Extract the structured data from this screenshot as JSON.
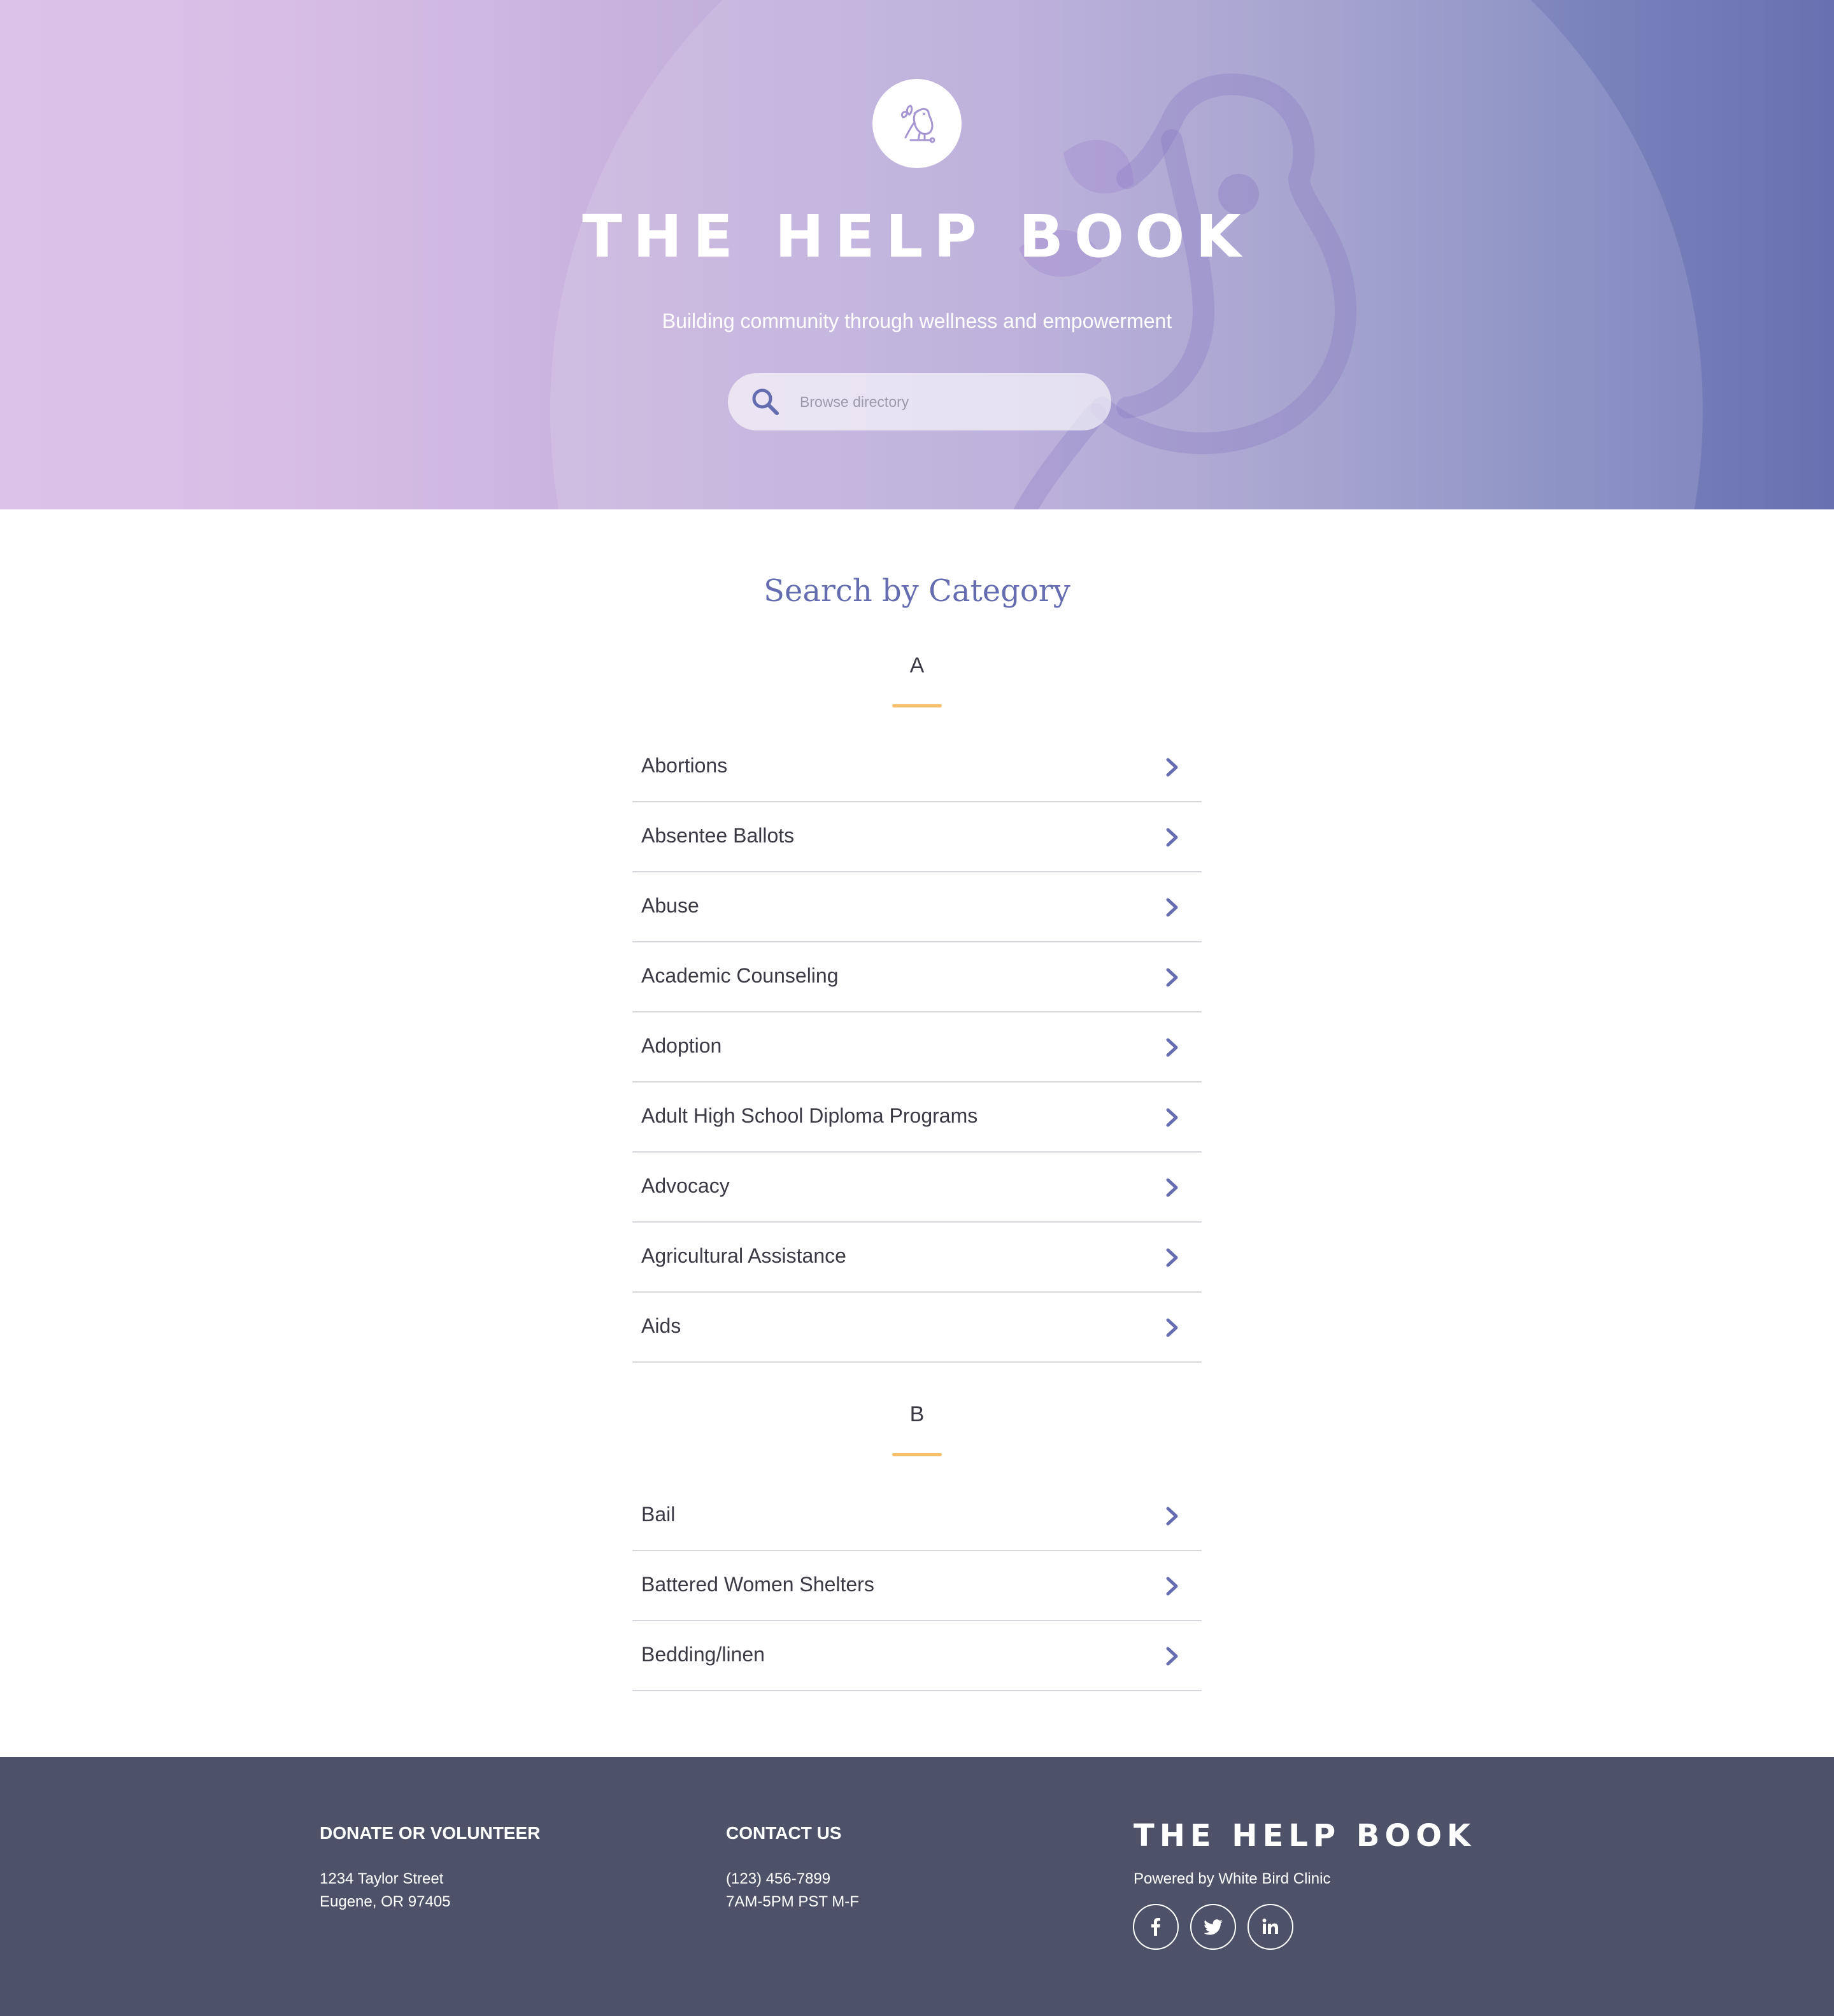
{
  "hero": {
    "title": "THE HELP BOOK",
    "subtitle": "Building community through wellness and empowerment",
    "logo_icon": "bird-icon",
    "search": {
      "placeholder": "Browse directory",
      "icon": "search-icon"
    }
  },
  "categories": {
    "heading": "Search by Category",
    "groups": [
      {
        "letter": "A",
        "items": [
          "Abortions",
          "Absentee Ballots",
          "Abuse",
          "Academic Counseling",
          "Adoption",
          "Adult High School Diploma Programs",
          "Advocacy",
          "Agricultural Assistance",
          "Aids"
        ]
      },
      {
        "letter": "B",
        "items": [
          "Bail",
          "Battered Women Shelters",
          "Bedding/linen"
        ]
      }
    ]
  },
  "footer": {
    "donate": {
      "heading": "DONATE OR VOLUNTEER",
      "line1": "1234 Taylor Street",
      "line2": "Eugene, OR 97405"
    },
    "contact": {
      "heading": "CONTACT US",
      "phone": "(123) 456-7899",
      "hours": "7AM-5PM PST M-F"
    },
    "brand": {
      "title": "THE HELP BOOK",
      "powered_by": "Powered by White Bird Clinic"
    },
    "social": [
      "facebook-icon",
      "twitter-icon",
      "linkedin-icon"
    ]
  },
  "colors": {
    "accent": "#656db0",
    "underline": "#f8c06a",
    "footer_bg": "#4e5268",
    "gradient_start": "#dcc2e8",
    "gradient_end": "#6870b1"
  }
}
